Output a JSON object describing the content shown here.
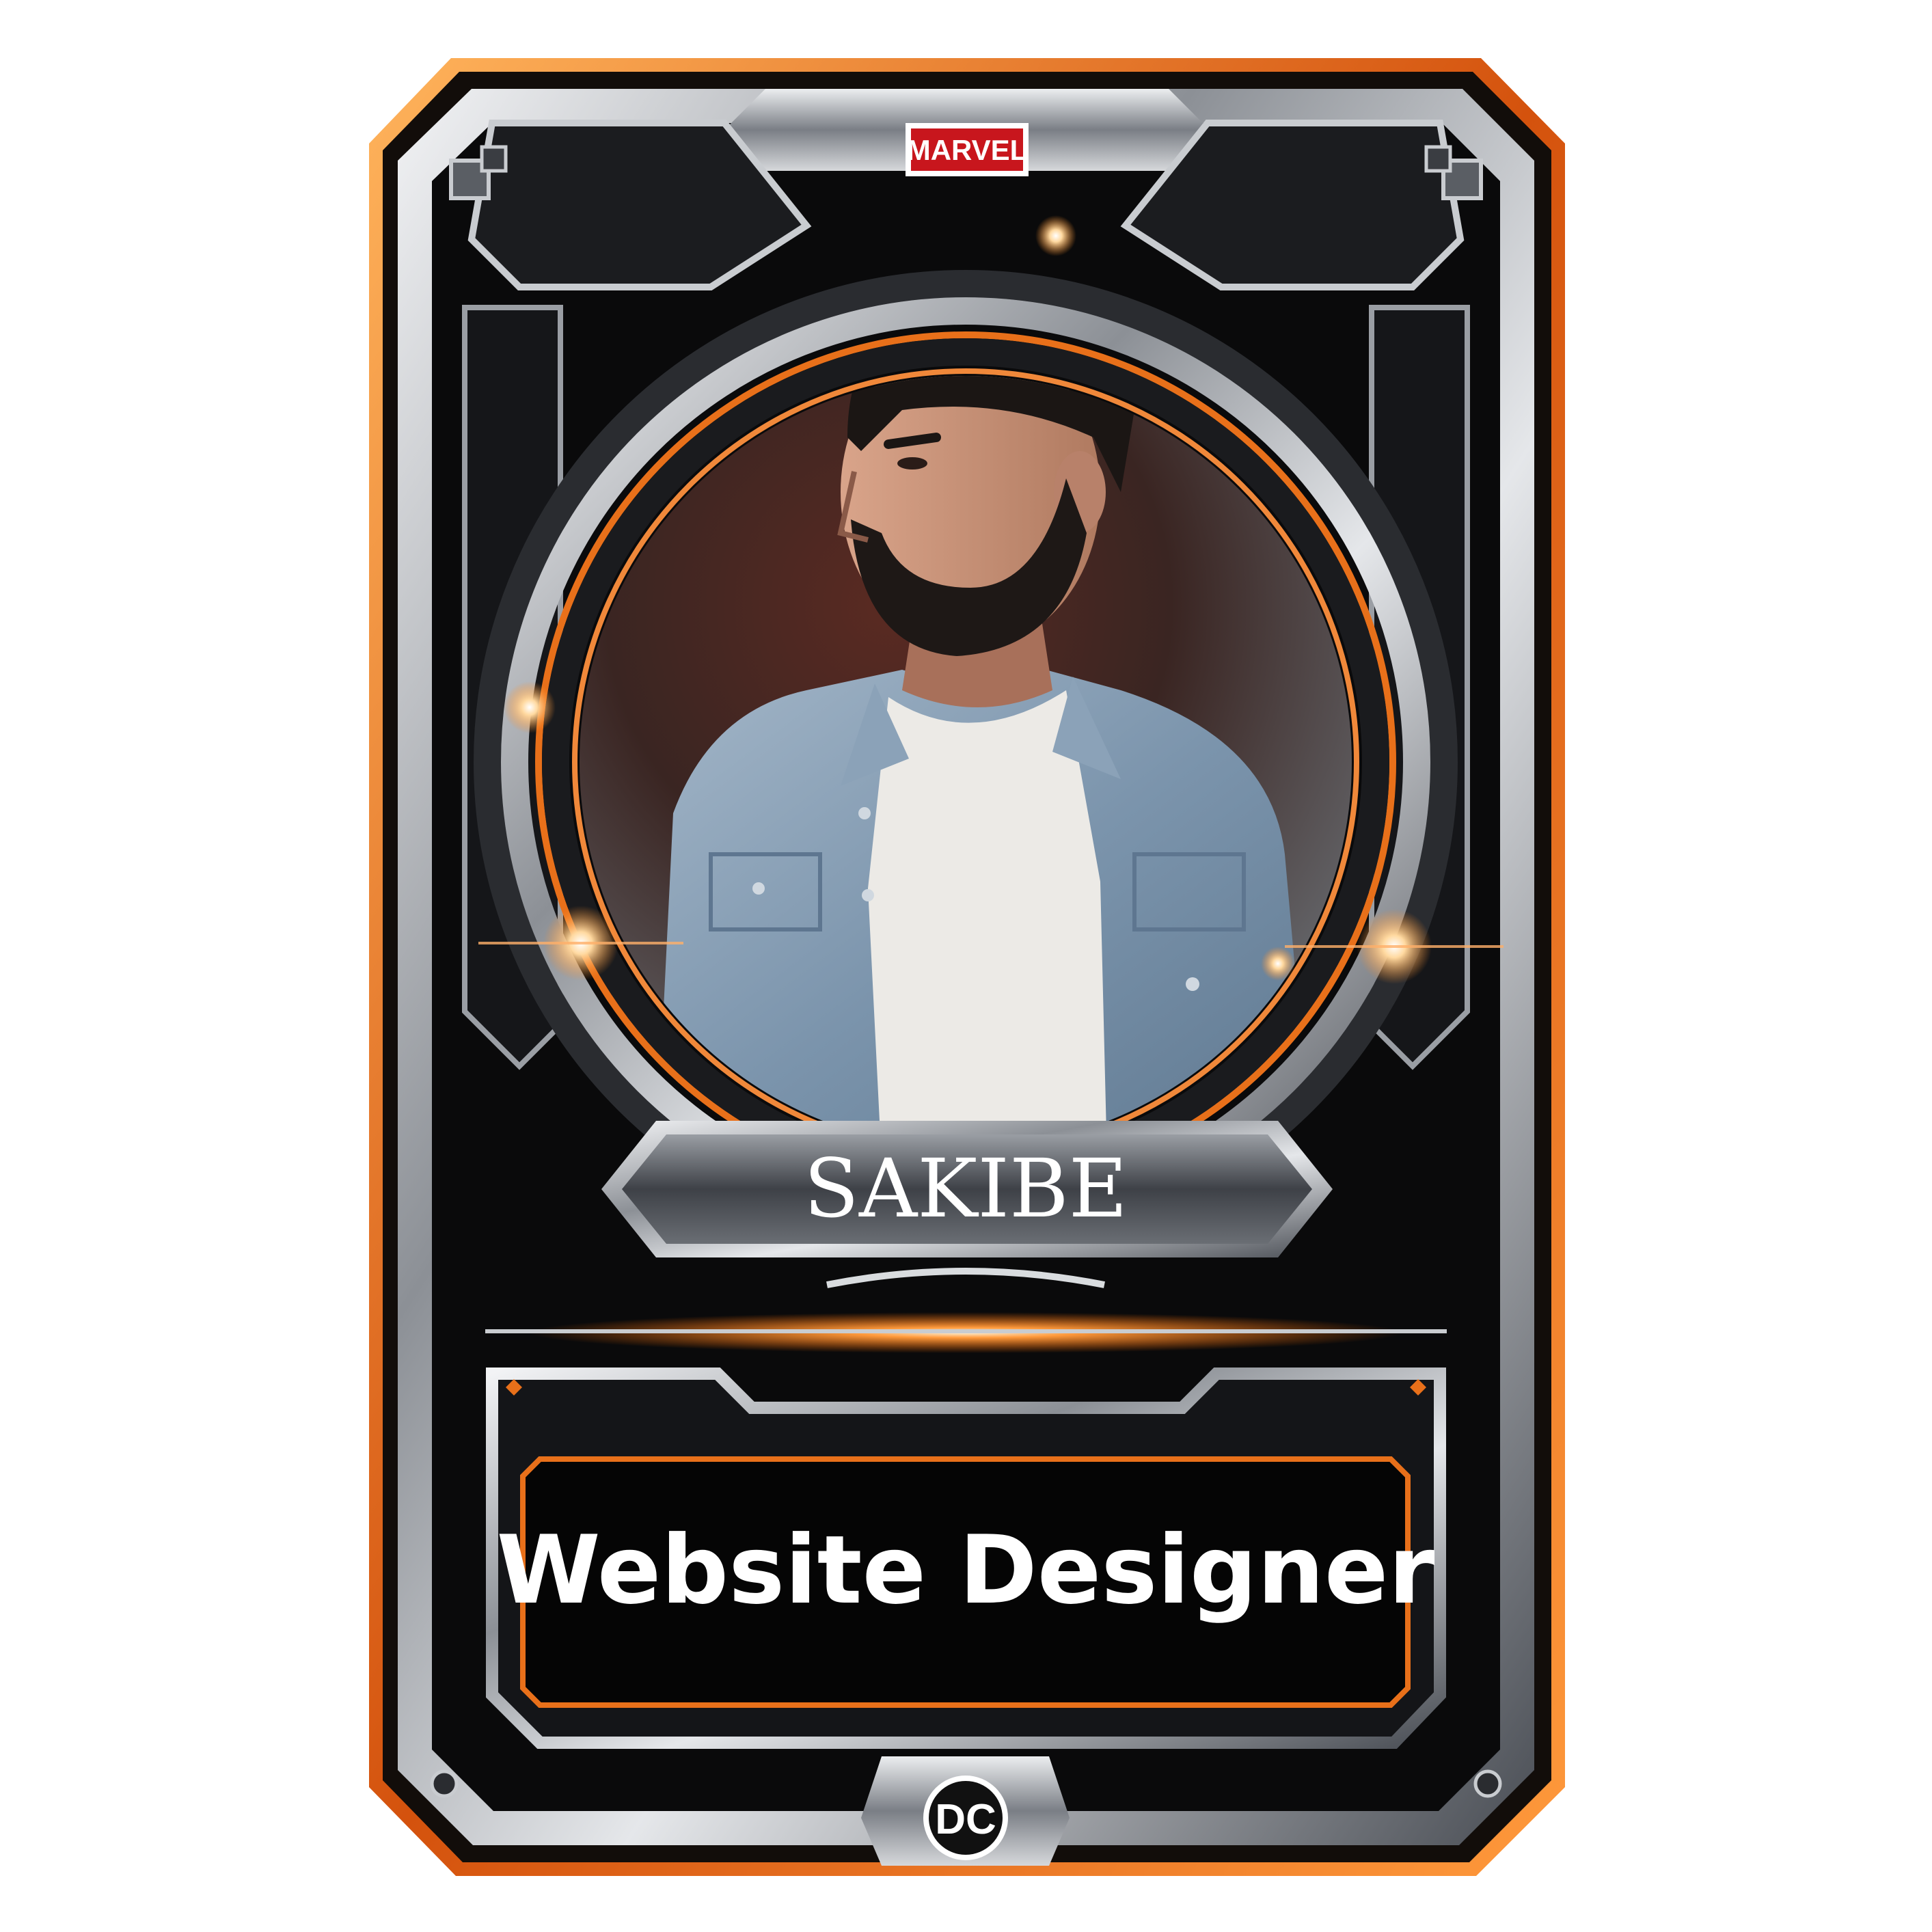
{
  "card": {
    "top_logo": "MARVEL",
    "name": "SAKIBE",
    "title": "Website Designer",
    "bottom_logo": "DC"
  },
  "colors": {
    "background": "#ffffff",
    "frame_orange": "#e8701a",
    "frame_glow": "#ff9a3c",
    "metal_light": "#d9dcdf",
    "metal_dark": "#3a3d42",
    "panel_black": "#060606",
    "marvel_red": "#c8161d",
    "text_white": "#ffffff",
    "jacket_blue": "#7f98b0",
    "tshirt_white": "#eeeeee",
    "hair_dark": "#1b1614"
  },
  "icons": {
    "top_badge": "marvel-logo",
    "bottom_badge": "dc-logo",
    "sparkles": "sparkle-icon"
  }
}
